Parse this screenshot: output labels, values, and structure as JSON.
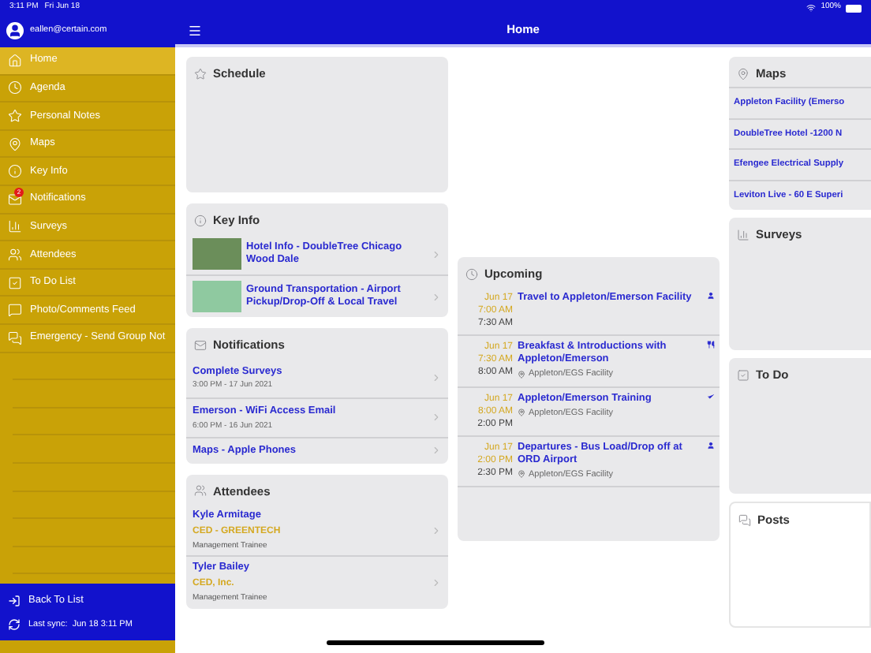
{
  "status_bar": {
    "time": "3:11 PM",
    "date": "Fri Jun 18",
    "battery": "100%"
  },
  "sidebar": {
    "user_email": "eallen@certain.com",
    "items": [
      {
        "label": "Home",
        "selected": true
      },
      {
        "label": "Agenda",
        "selected": false
      },
      {
        "label": "Personal Notes",
        "selected": false
      },
      {
        "label": "Maps",
        "selected": false
      },
      {
        "label": "Key Info",
        "selected": false
      },
      {
        "label": "Notifications",
        "selected": false,
        "badge": "2"
      },
      {
        "label": "Surveys",
        "selected": false
      },
      {
        "label": "Attendees",
        "selected": false
      },
      {
        "label": "To Do List",
        "selected": false
      },
      {
        "label": "Photo/Comments Feed",
        "selected": false
      },
      {
        "label": "Emergency - Send Group Not",
        "selected": false
      }
    ],
    "back_button": "Back To List",
    "last_sync": "Last sync:  Jun 18 3:11 PM"
  },
  "header": {
    "title": "Home"
  },
  "schedule": {
    "title": "Schedule"
  },
  "key_info": {
    "title": "Key Info",
    "items": [
      {
        "title": "Hotel Info - DoubleTree Chicago Wood Dale"
      },
      {
        "title": "Ground Transportation - Airport Pickup/Drop-Off & Local Travel"
      }
    ]
  },
  "notifications": {
    "title": "Notifications",
    "items": [
      {
        "title": "Complete Surveys",
        "time": "3:00 PM - 17 Jun 2021"
      },
      {
        "title": "Emerson - WiFi Access Email",
        "time": "6:00 PM - 16 Jun 2021"
      },
      {
        "title": "Maps - Apple Phones"
      }
    ]
  },
  "attendees": {
    "title": "Attendees",
    "items": [
      {
        "name": "Kyle Armitage",
        "company": "CED - GREENTECH",
        "role": "Management Trainee"
      },
      {
        "name": "Tyler Bailey",
        "company": "CED, Inc.",
        "role": "Management Trainee"
      }
    ]
  },
  "upcoming": {
    "title": "Upcoming",
    "items": [
      {
        "date": "Jun 17",
        "start": "7:00 AM",
        "end": "7:30 AM",
        "title": "Travel to Appleton/Emerson Facility"
      },
      {
        "date": "Jun 17",
        "start": "7:30 AM",
        "end": "8:00 AM",
        "title": "Breakfast & Introductions with Appleton/Emerson",
        "location": "Appleton/EGS Facility"
      },
      {
        "date": "Jun 17",
        "start": "8:00 AM",
        "end": "2:00 PM",
        "title": "Appleton/Emerson Training",
        "location": "Appleton/EGS Facility"
      },
      {
        "date": "Jun 17",
        "start": "2:00 PM",
        "end": "2:30 PM",
        "title": "Departures - Bus Load/Drop off at ORD Airport",
        "location": "Appleton/EGS Facility"
      }
    ]
  },
  "maps": {
    "title": "Maps",
    "items": [
      "Appleton Facility (Emerso",
      "DoubleTree Hotel -1200 N",
      "Efengee Electrical Supply",
      "Leviton Live - 60 E Superi"
    ]
  },
  "surveys": {
    "title": "Surveys"
  },
  "todo": {
    "title": "To Do"
  },
  "posts": {
    "title": "Posts"
  }
}
